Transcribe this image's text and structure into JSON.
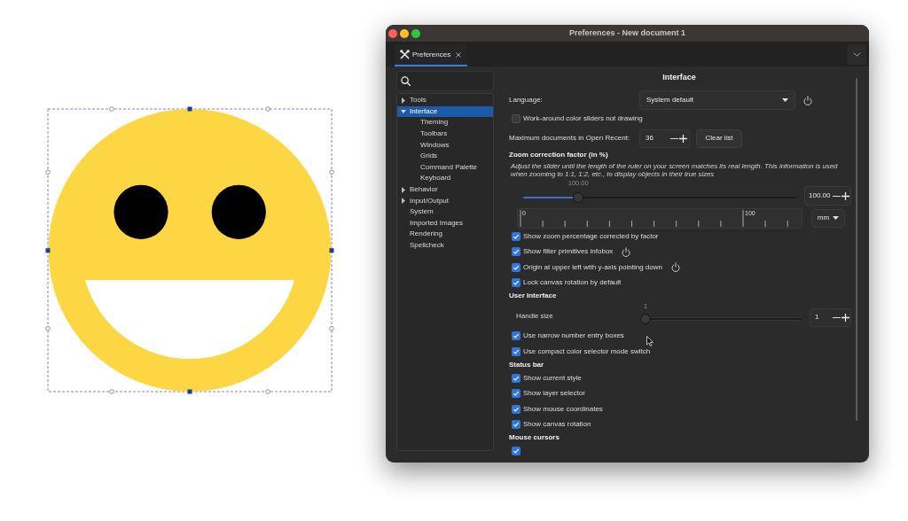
{
  "window": {
    "title": "Preferences - New document 1"
  },
  "tabs": [
    {
      "label": "Preferences",
      "selected": true
    }
  ],
  "sidebar": {
    "items": [
      {
        "label": "Tools",
        "expanded": false,
        "selected": false
      },
      {
        "label": "Interface",
        "expanded": true,
        "selected": true,
        "children": [
          {
            "label": "Theming",
            "selected": false
          },
          {
            "label": "Toolbars",
            "selected": false
          },
          {
            "label": "Windows",
            "selected": false
          },
          {
            "label": "Grids",
            "selected": false
          },
          {
            "label": "Command Palette",
            "selected": false
          },
          {
            "label": "Keyboard",
            "selected": false
          }
        ]
      },
      {
        "label": "Behavior",
        "expanded": false,
        "selected": false
      },
      {
        "label": "Input/Output",
        "expanded": false,
        "selected": false
      },
      {
        "label": "System",
        "selected": false
      },
      {
        "label": "Imported Images",
        "selected": false
      },
      {
        "label": "Rendering",
        "selected": false
      },
      {
        "label": "Spellcheck",
        "selected": false
      }
    ]
  },
  "page": {
    "title": "Interface",
    "rows": [
      {
        "kind": "dropdown",
        "label": "Language:",
        "value": "System default",
        "needs_restart": true
      },
      {
        "kind": "checkbox",
        "label": "Work-around color sliders not drawing",
        "checked": false,
        "needs_restart": false
      },
      {
        "kind": "spin",
        "label": "Maximum documents in Open Recent:",
        "value": "36",
        "button": "Clear list"
      },
      {
        "kind": "heading",
        "label": "Zoom correction factor (in %)"
      },
      {
        "kind": "note",
        "text": "Adjust the slider until the length of the ruler on your screen matches its real length. This information is used when zooming to 1:1, 1:2, etc., to display objects in their true sizes"
      },
      {
        "kind": "slider",
        "reading": "100.00",
        "level": 0.19,
        "value": "100.00"
      },
      {
        "kind": "ruler",
        "labels": [
          "0",
          "100"
        ],
        "unit": "mm"
      },
      {
        "kind": "checkbox",
        "label": "Show zoom percentage corrected by factor",
        "checked": true,
        "needs_restart": false
      },
      {
        "kind": "checkbox",
        "label": "Show filter primitives infobox",
        "checked": true,
        "needs_restart": true
      },
      {
        "kind": "checkbox",
        "label": "Origin at upper left with y-axis pointing down",
        "checked": true,
        "needs_restart": true
      },
      {
        "kind": "checkbox",
        "label": "Lock canvas rotation by default",
        "checked": true,
        "needs_restart": false
      },
      {
        "kind": "heading",
        "label": "User Interface"
      },
      {
        "kind": "slider",
        "label": "Handle size",
        "reading": "1",
        "level": 0,
        "value": "1"
      },
      {
        "kind": "checkbox",
        "label": "Use narrow number entry boxes",
        "checked": true,
        "needs_restart": false
      },
      {
        "kind": "checkbox",
        "label": "Use compact color selector mode switch",
        "checked": true,
        "needs_restart": false
      },
      {
        "kind": "heading",
        "label": "Status bar"
      },
      {
        "kind": "checkbox",
        "label": "Show current style",
        "checked": true,
        "needs_restart": false
      },
      {
        "kind": "checkbox",
        "label": "Show layer selector",
        "checked": true,
        "needs_restart": false
      },
      {
        "kind": "checkbox",
        "label": "Show mouse coordinates",
        "checked": true,
        "needs_restart": false
      },
      {
        "kind": "checkbox",
        "label": "Show canvas rotation",
        "checked": true,
        "needs_restart": false
      },
      {
        "kind": "heading",
        "label": "Mouse cursors"
      },
      {
        "kind": "checkbox",
        "checked": true
      }
    ]
  }
}
